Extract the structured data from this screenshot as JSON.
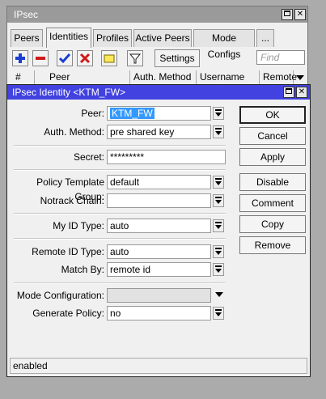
{
  "parent_window": {
    "title": "IPsec",
    "tabs": [
      "Peers",
      "Identities",
      "Profiles",
      "Active Peers",
      "Mode Configs",
      "..."
    ],
    "active_tab": "Identities",
    "toolbar": {
      "settings_label": "Settings",
      "find_placeholder": "Find"
    },
    "columns": [
      "#",
      "Peer",
      "Auth. Method",
      "Username",
      "Remote"
    ]
  },
  "dialog": {
    "title": "IPsec Identity <KTM_FW>",
    "fields": {
      "peer": {
        "label": "Peer:",
        "value": "KTM_FW"
      },
      "auth_method": {
        "label": "Auth. Method:",
        "value": "pre shared key"
      },
      "secret": {
        "label": "Secret:",
        "value": "*********"
      },
      "policy_template_group": {
        "label": "Policy Template Group:",
        "value": "default"
      },
      "notrack_chain": {
        "label": "Notrack Chain:",
        "value": ""
      },
      "my_id_type": {
        "label": "My ID Type:",
        "value": "auto"
      },
      "remote_id_type": {
        "label": "Remote ID Type:",
        "value": "auto"
      },
      "match_by": {
        "label": "Match By:",
        "value": "remote id"
      },
      "mode_configuration": {
        "label": "Mode Configuration:",
        "value": ""
      },
      "generate_policy": {
        "label": "Generate Policy:",
        "value": "no"
      }
    },
    "buttons": {
      "ok": "OK",
      "cancel": "Cancel",
      "apply": "Apply",
      "disable": "Disable",
      "comment": "Comment",
      "copy": "Copy",
      "remove": "Remove"
    },
    "status": "enabled"
  },
  "colors": {
    "dialog_titlebar": "#4242e0",
    "inactive_titlebar": "#9a9a9a",
    "background": "#ababab"
  }
}
